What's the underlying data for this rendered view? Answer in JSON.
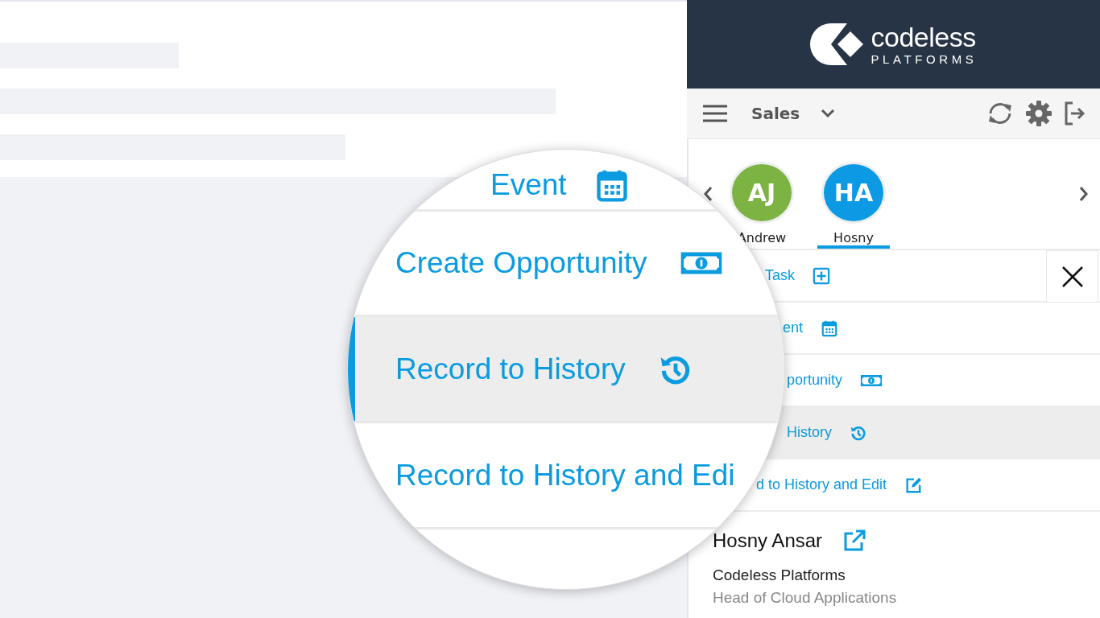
{
  "header": {
    "logo_word": "codeless",
    "logo_sub": "PLATFORMS"
  },
  "toolbar": {
    "menu": "Sales"
  },
  "contacts": [
    {
      "initials": "AJ",
      "name": "Andrew",
      "color": "#7cb342",
      "selected": false
    },
    {
      "initials": "HA",
      "name": "Hosny",
      "color": "#0b9ae3",
      "selected": true
    }
  ],
  "actions": [
    {
      "label": "Task",
      "kind": "plus",
      "selected": false
    },
    {
      "label": "ent",
      "kind": "calendar",
      "selected": false
    },
    {
      "label": "portunity",
      "kind": "cash",
      "selected": false
    },
    {
      "label": "History",
      "kind": "history",
      "selected": true
    },
    {
      "label": "d to History and Edit",
      "kind": "edit",
      "selected": false
    }
  ],
  "contact_card": {
    "name": "Hosny Ansar",
    "company": "Codeless Platforms",
    "title": "Head of Cloud Applications"
  },
  "magnifier": {
    "actions": [
      {
        "label": "Event",
        "kind": "calendar",
        "selected": false
      },
      {
        "label": "Create Opportunity",
        "kind": "cash",
        "selected": false
      },
      {
        "label": "Record to History",
        "kind": "history",
        "selected": true
      },
      {
        "label": "Record to History and Edi",
        "selected": false
      }
    ]
  }
}
